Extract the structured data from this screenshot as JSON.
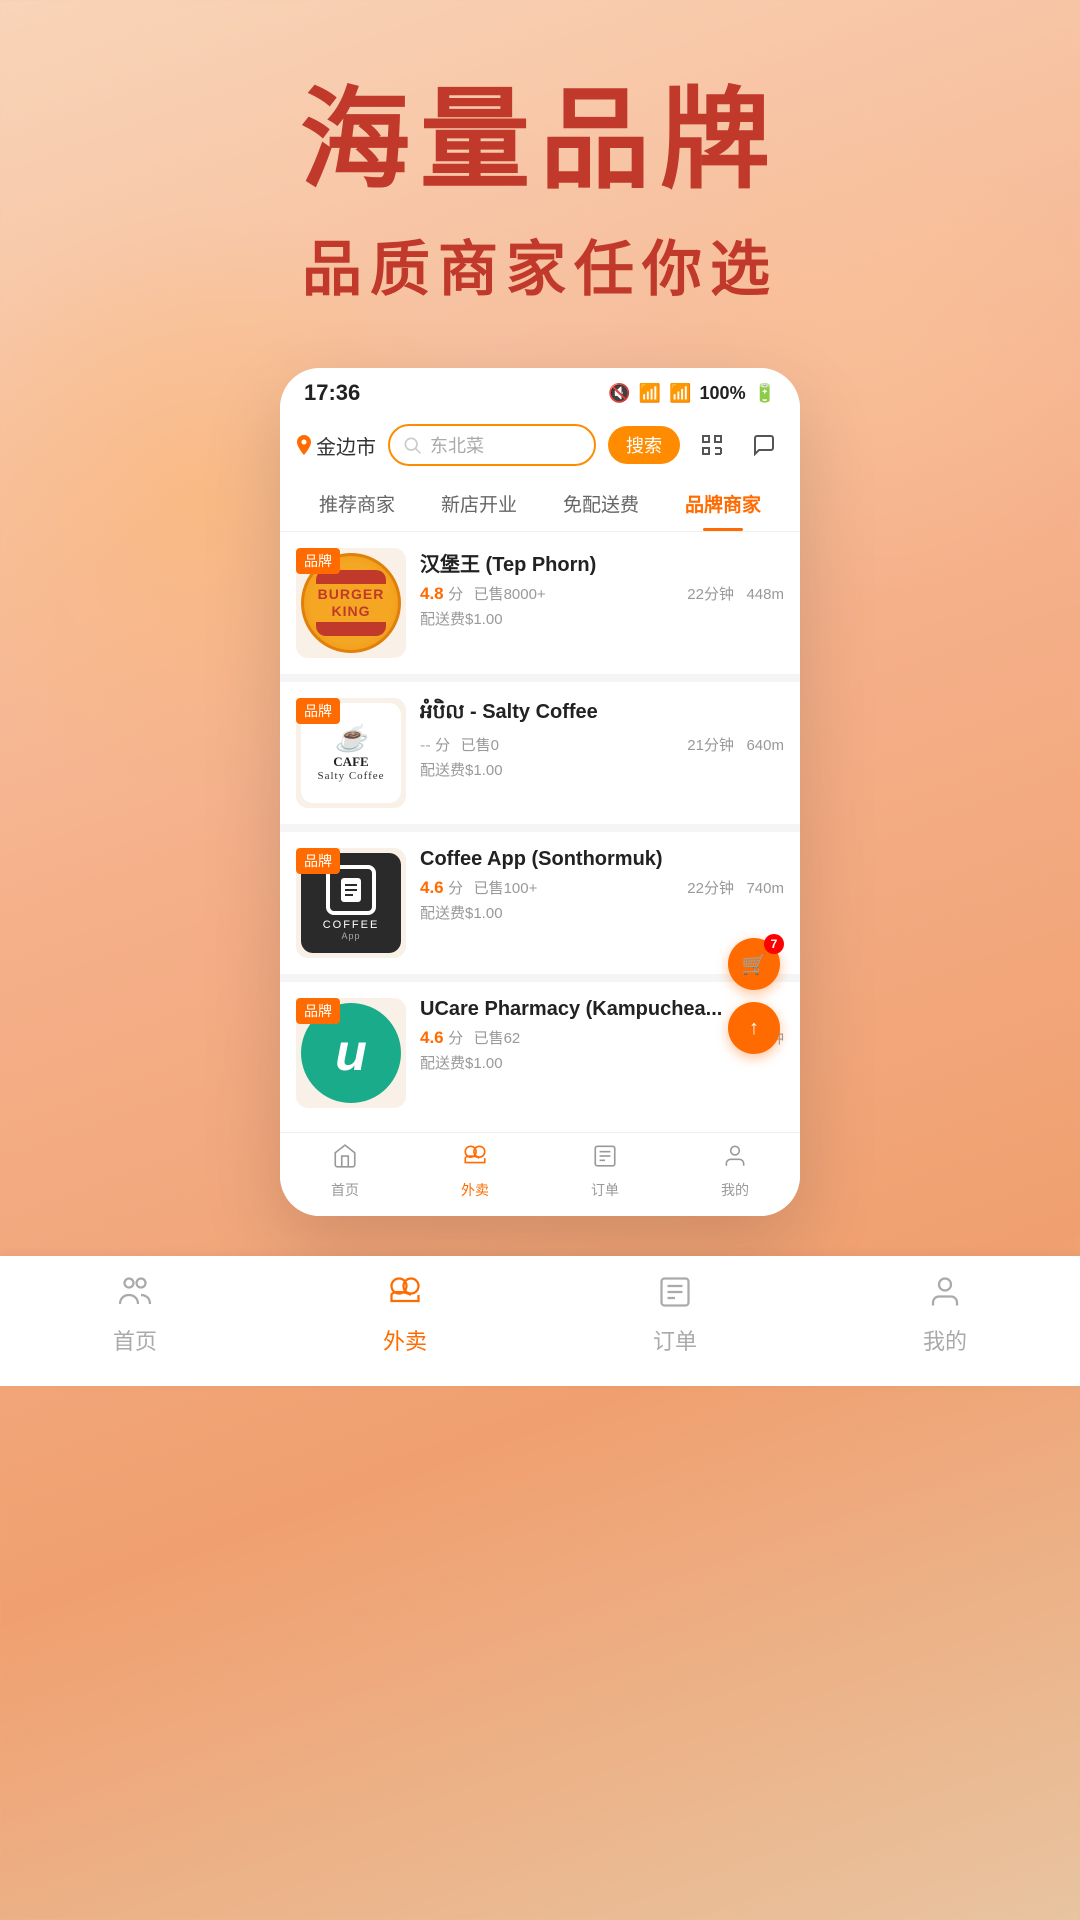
{
  "hero": {
    "title": "海量品牌",
    "subtitle": "品质商家任你选"
  },
  "status_bar": {
    "time": "17:36",
    "battery": "100%"
  },
  "location": {
    "city": "金边市"
  },
  "search": {
    "placeholder": "东北菜",
    "button_label": "搜索"
  },
  "tabs": [
    {
      "label": "推荐商家",
      "active": false
    },
    {
      "label": "新店开业",
      "active": false
    },
    {
      "label": "免配送费",
      "active": false
    },
    {
      "label": "品牌商家",
      "active": true
    }
  ],
  "stores": [
    {
      "brand_badge": "品牌",
      "name": "汉堡王 (Tep Phorn)",
      "rating": "4.8",
      "rating_unit": "分",
      "sales": "已售8000+",
      "time": "22分钟",
      "distance": "448m",
      "delivery_fee": "配送费$1.00",
      "logo_type": "burger_king"
    },
    {
      "brand_badge": "品牌",
      "name": "អំបិល - Salty Coffee",
      "rating": "--",
      "rating_unit": "分",
      "sales": "已售0",
      "time": "21分钟",
      "distance": "640m",
      "delivery_fee": "配送费$1.00",
      "logo_type": "salty_coffee"
    },
    {
      "brand_badge": "品牌",
      "name": "Coffee App (Sonthormuk)",
      "rating": "4.6",
      "rating_unit": "分",
      "sales": "已售100+",
      "time": "22分钟",
      "distance": "740m",
      "delivery_fee": "配送费$1.00",
      "logo_type": "coffee_app"
    },
    {
      "brand_badge": "品牌",
      "name": "UCare Pharmacy (Kampuchea...",
      "rating": "4.6",
      "rating_unit": "分",
      "sales": "已售62",
      "time": "22分钟",
      "distance": "",
      "delivery_fee": "配送费$1.00",
      "logo_type": "ucare"
    }
  ],
  "fab": {
    "cart_badge": "7"
  },
  "bottom_nav": [
    {
      "label": "首页",
      "active": false,
      "icon": "home"
    },
    {
      "label": "外卖",
      "active": true,
      "icon": "food"
    },
    {
      "label": "订单",
      "active": false,
      "icon": "order"
    },
    {
      "label": "我的",
      "active": false,
      "icon": "profile"
    }
  ]
}
